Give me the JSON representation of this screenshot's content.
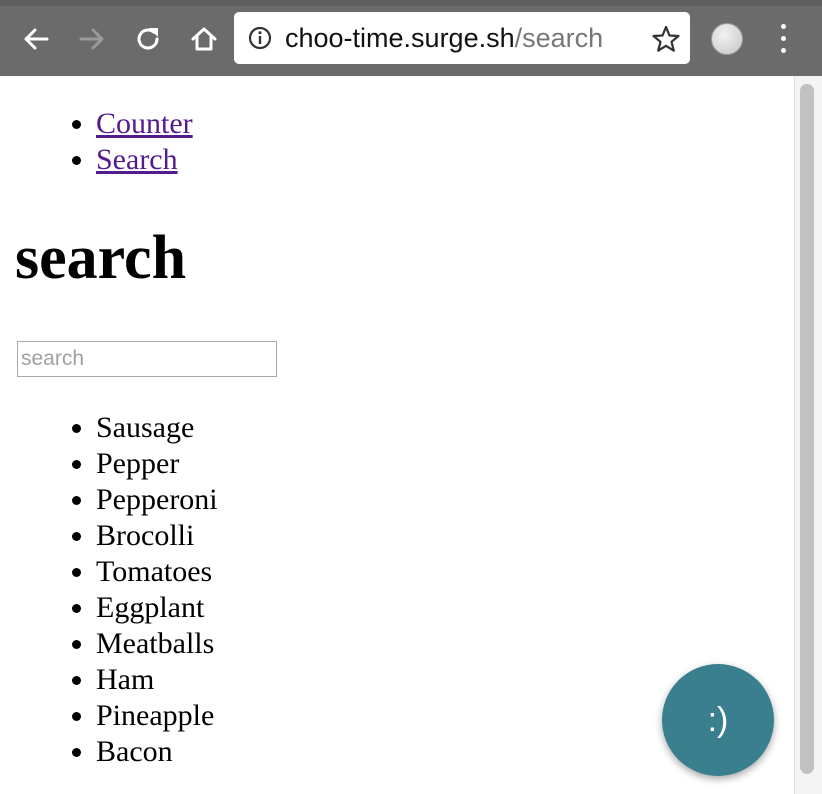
{
  "browser": {
    "url_host": "choo-time.surge.sh",
    "url_path": "/search",
    "icons": [
      "back-arrow-icon",
      "forward-arrow-icon",
      "reload-icon",
      "home-icon",
      "info-icon",
      "star-icon",
      "profile-icon",
      "menu-icon"
    ]
  },
  "nav": {
    "items": [
      {
        "label": "Counter"
      },
      {
        "label": "Search"
      }
    ]
  },
  "page": {
    "heading": "search",
    "search_placeholder": "search",
    "search_value": "",
    "results": [
      "Sausage",
      "Pepper",
      "Pepperoni",
      "Brocolli",
      "Tomatoes",
      "Eggplant",
      "Meatballs",
      "Ham",
      "Pineapple",
      "Bacon"
    ]
  },
  "fab": {
    "label": ":)"
  },
  "colors": {
    "toolbar": "#6b6b6b",
    "link": "#551a8b",
    "fab": "#3a7f8d"
  }
}
